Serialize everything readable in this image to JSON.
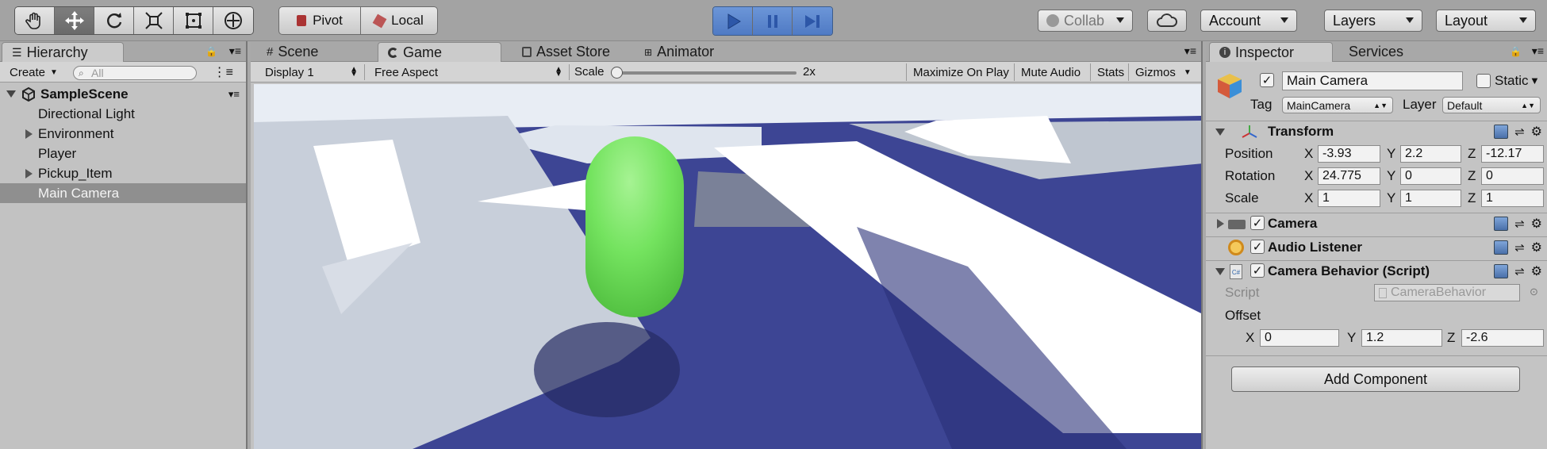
{
  "toolbar": {
    "tools": [
      "hand-tool",
      "move-tool",
      "rotate-tool",
      "scale-tool",
      "rect-tool",
      "transform-tool"
    ],
    "pivot_label": "Pivot",
    "local_label": "Local",
    "collab_label": "Collab",
    "account_label": "Account",
    "layers_label": "Layers",
    "layout_label": "Layout"
  },
  "hierarchy": {
    "tab_label": "Hierarchy",
    "create_label": "Create",
    "search_placeholder": "All",
    "scene_name": "SampleScene",
    "items": [
      {
        "label": "Directional Light",
        "expandable": false,
        "selected": false
      },
      {
        "label": "Environment",
        "expandable": true,
        "selected": false
      },
      {
        "label": "Player",
        "expandable": false,
        "selected": false
      },
      {
        "label": "Pickup_Item",
        "expandable": true,
        "selected": false
      },
      {
        "label": "Main Camera",
        "expandable": false,
        "selected": true
      }
    ]
  },
  "center_tabs": {
    "scene": "Scene",
    "game": "Game",
    "asset_store": "Asset Store",
    "animator": "Animator"
  },
  "game_bar": {
    "display": "Display 1",
    "aspect": "Free Aspect",
    "scale_label": "Scale",
    "scale_value": "2x",
    "maximize": "Maximize On Play",
    "mute": "Mute Audio",
    "stats": "Stats",
    "gizmos": "Gizmos"
  },
  "inspector": {
    "tab_label": "Inspector",
    "services_label": "Services",
    "object_name": "Main Camera",
    "static_label": "Static",
    "tag_label": "Tag",
    "tag_value": "MainCamera",
    "layer_label": "Layer",
    "layer_value": "Default",
    "transform": {
      "title": "Transform",
      "position_label": "Position",
      "rotation_label": "Rotation",
      "scale_label": "Scale",
      "position": {
        "x": "-3.93",
        "y": "2.2",
        "z": "-12.17"
      },
      "rotation": {
        "x": "24.775",
        "y": "0",
        "z": "0"
      },
      "scale": {
        "x": "1",
        "y": "1",
        "z": "1"
      }
    },
    "camera_title": "Camera",
    "audio_title": "Audio Listener",
    "behavior": {
      "title": "Camera Behavior (Script)",
      "script_label": "Script",
      "script_value": "CameraBehavior",
      "offset_label": "Offset",
      "offset": {
        "x": "0",
        "y": "1.2",
        "z": "-2.6"
      }
    },
    "add_component": "Add Component"
  },
  "axis_labels": {
    "x": "X",
    "y": "Y",
    "z": "Z"
  },
  "colors": {
    "play_active": "#4f7ac4",
    "floor": "#3d4594",
    "player": "#72e25c",
    "selection": "#8f8f8f"
  }
}
